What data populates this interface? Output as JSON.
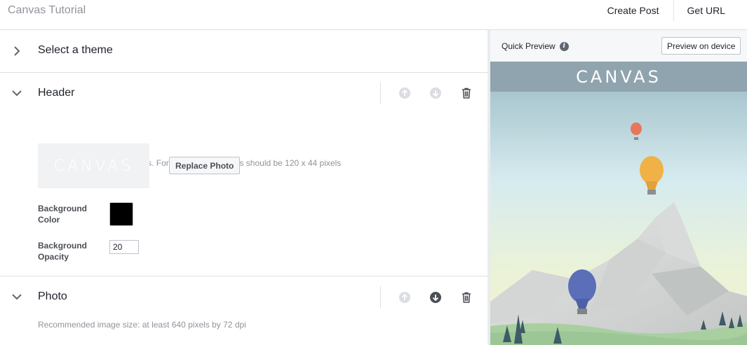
{
  "app": {
    "title": "Canvas Tutorial"
  },
  "top_actions": {
    "create_post": "Create Post",
    "get_url": "Get URL"
  },
  "sections": {
    "theme": {
      "label": "Select a theme",
      "expanded": false
    },
    "header": {
      "label": "Header",
      "expanded": true,
      "help": "Upload a logo for your Canvas. For best results images should be 120 x 44 pixels",
      "logo_text": "CANVAS",
      "replace_photo": "Replace Photo",
      "background_color_label": "Background Color",
      "background_color": "#000000",
      "background_opacity_label": "Background Opacity",
      "background_opacity": "20"
    },
    "photo": {
      "label": "Photo",
      "expanded": true,
      "help": "Recommended image size: at least 640 pixels by 72 dpi"
    }
  },
  "preview": {
    "quick_preview_label": "Quick Preview",
    "info_icon": "info-icon",
    "preview_button": "Preview on device",
    "brand_text": "CANVAS",
    "bar_color": "#8fa4ae"
  }
}
